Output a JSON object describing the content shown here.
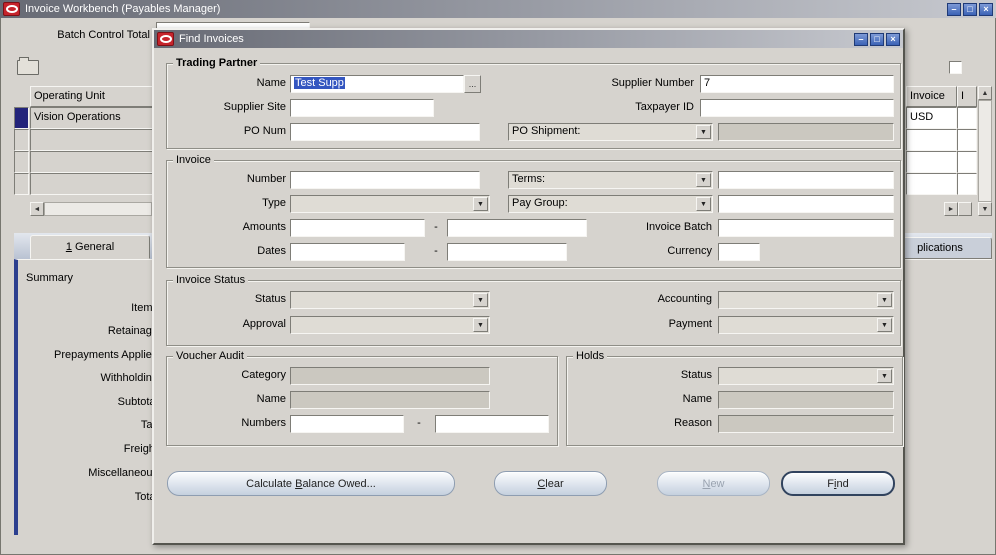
{
  "icons": {
    "dropdown_arrow": "▼",
    "lov_ellipsis": "...",
    "scroll_up": "▲",
    "scroll_down": "▼",
    "scroll_left": "◄",
    "scroll_right": "►",
    "minimize": "–",
    "maximize": "□",
    "close": "×",
    "range_dash": "-"
  },
  "colors": {
    "oracle_red": "#c6242c",
    "selection_blue": "#3456c0",
    "window_control_blue": "#3b62b5",
    "window_bg": "#d6d3ce",
    "tab_edge_blue": "#2c3f8f"
  },
  "window": {
    "title": "Invoice Workbench (Payables Manager)"
  },
  "background": {
    "batch_control_total_label": "Batch Control Total",
    "grid": {
      "left_header": "Operating Unit",
      "rows": [
        "Vision Operations",
        "",
        "",
        ""
      ],
      "right_header": "Invoice",
      "right_header_partial": "I",
      "right_rows": [
        "USD",
        "",
        "",
        ""
      ]
    },
    "tabs": {
      "active_mnemonic": "1",
      "active_rest": " General",
      "partial": "plications"
    },
    "summary": {
      "title": "Summary",
      "labels": [
        "Items",
        "Retainage",
        "Prepayments Applied",
        "Withholding",
        "Subtotal",
        "Tax",
        "Freight",
        "Miscellaneous",
        "Total"
      ]
    }
  },
  "dialog": {
    "title": "Find Invoices",
    "trading_partner": {
      "legend": "Trading Partner",
      "name_label": "Name",
      "name_value": "Test Supp",
      "supplier_number_label": "Supplier Number",
      "supplier_number_value": "7",
      "supplier_site_label": "Supplier Site",
      "supplier_site_value": "",
      "taxpayer_id_label": "Taxpayer ID",
      "taxpayer_id_value": "",
      "po_num_label": "PO Num",
      "po_num_value": "",
      "po_shipment_combo": "PO Shipment:",
      "po_shipment_value": ""
    },
    "invoice": {
      "legend": "Invoice",
      "number_label": "Number",
      "number_value": "",
      "terms_combo": "Terms:",
      "terms_value": "",
      "type_label": "Type",
      "type_value": "",
      "pay_group_combo": "Pay Group:",
      "pay_group_value": "",
      "amounts_label": "Amounts",
      "amount_from": "",
      "amount_to": "",
      "invoice_batch_label": "Invoice Batch",
      "invoice_batch_value": "",
      "dates_label": "Dates",
      "date_from": "",
      "date_to": "",
      "currency_label": "Currency",
      "currency_value": ""
    },
    "invoice_status": {
      "legend": "Invoice Status",
      "status_label": "Status",
      "status_value": "",
      "accounting_label": "Accounting",
      "accounting_value": "",
      "approval_label": "Approval",
      "approval_value": "",
      "payment_label": "Payment",
      "payment_value": ""
    },
    "voucher_audit": {
      "legend": "Voucher Audit",
      "category_label": "Category",
      "category_value": "",
      "name_label": "Name",
      "name_value": "",
      "numbers_label": "Numbers",
      "numbers_from": "",
      "numbers_to": ""
    },
    "holds": {
      "legend": "Holds",
      "status_label": "Status",
      "status_value": "",
      "name_label": "Name",
      "name_value": "",
      "reason_label": "Reason",
      "reason_value": ""
    },
    "buttons": {
      "calculate": {
        "pre": "Calculate ",
        "mn": "B",
        "post": "alance Owed..."
      },
      "clear": {
        "pre": "",
        "mn": "C",
        "post": "lear"
      },
      "new": {
        "pre": "",
        "mn": "N",
        "post": "ew"
      },
      "find": {
        "pre": "F",
        "mn": "i",
        "post": "nd"
      }
    }
  }
}
